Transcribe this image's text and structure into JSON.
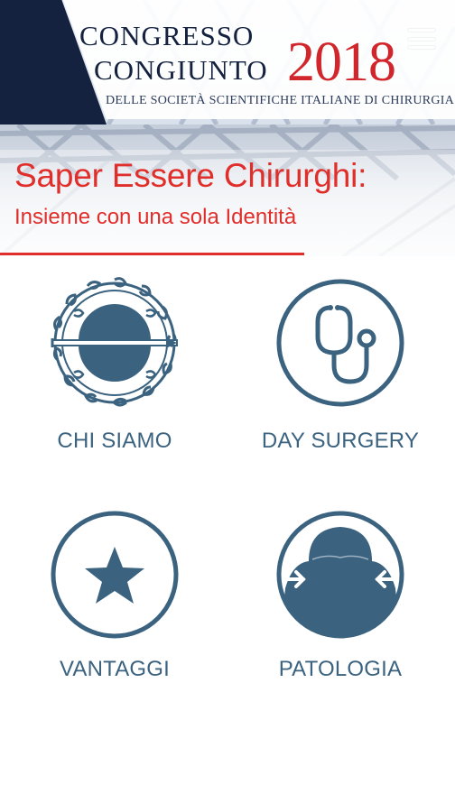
{
  "header": {
    "title_line1": "CONGRESSO",
    "title_line2": "CONGIUNTO",
    "year": "2018",
    "subtitle": "DELLE SOCIETÀ SCIENTIFICHE ITALIANE DI CHIRURGIA",
    "menu_icon": "hamburger-menu-icon"
  },
  "banner": {
    "headline": "Saper Essere Chirurghi:",
    "subheadline": "Insieme con una sola Identità"
  },
  "tiles": [
    {
      "label": "CHI SIAMO",
      "icon": "society-emblem-icon"
    },
    {
      "label": "DAY SURGERY",
      "icon": "stethoscope-icon"
    },
    {
      "label": "VANTAGGI",
      "icon": "star-icon"
    },
    {
      "label": "PATOLOGIA",
      "icon": "torso-arrows-icon"
    }
  ],
  "colors": {
    "navy": "#14213f",
    "accent_red": "#e02e2b",
    "icon_blue": "#3b6380",
    "background": "#ffffff"
  }
}
